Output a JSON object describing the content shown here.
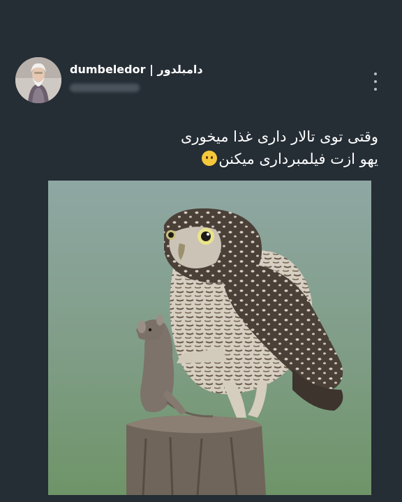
{
  "post": {
    "author_display": "dumbeledor | دامبلدور",
    "caption_lines": [
      "وقتی توی تالار داری غذا میخوری",
      "یهو ازت فیلمبرداری میکنن"
    ],
    "caption_emoji": "smiling-face-with-tear-icon"
  },
  "colors": {
    "background": "#252d35",
    "text": "#ffffff",
    "menu_dots": "#b9bec3"
  }
}
